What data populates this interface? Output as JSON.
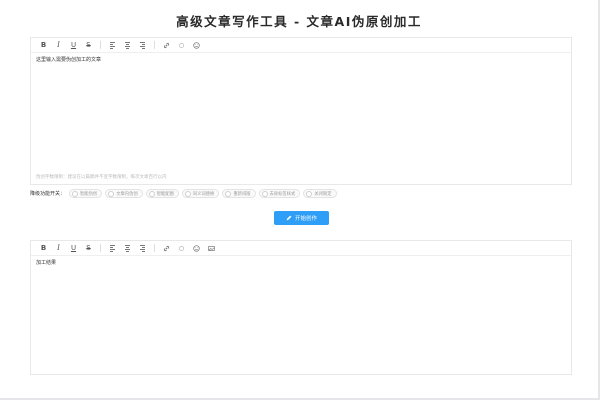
{
  "page": {
    "title": "高级文章写作工具 - 文章AI伪原创加工"
  },
  "top_editor": {
    "toolbar": {
      "bold": "B",
      "italic": "I",
      "underline": "U",
      "strike": "S"
    },
    "content": "这里输入需要伪创加工的文章",
    "hint": "伪创字数限制：建议在以篇稿件不变字数限制，每次文章百行以内"
  },
  "switches": {
    "label": "降级功能开关：",
    "options": [
      "智能伪创",
      "文章内伪创",
      "智能配图",
      "同义词替换",
      "重新排版",
      "去除标签样式",
      "关闭限定"
    ]
  },
  "action": {
    "start_label": "开始创作",
    "accent": "#2f9ef7"
  },
  "bottom_editor": {
    "toolbar": {
      "bold": "B",
      "italic": "I",
      "underline": "U",
      "strike": "S"
    },
    "content": "加工结果"
  }
}
